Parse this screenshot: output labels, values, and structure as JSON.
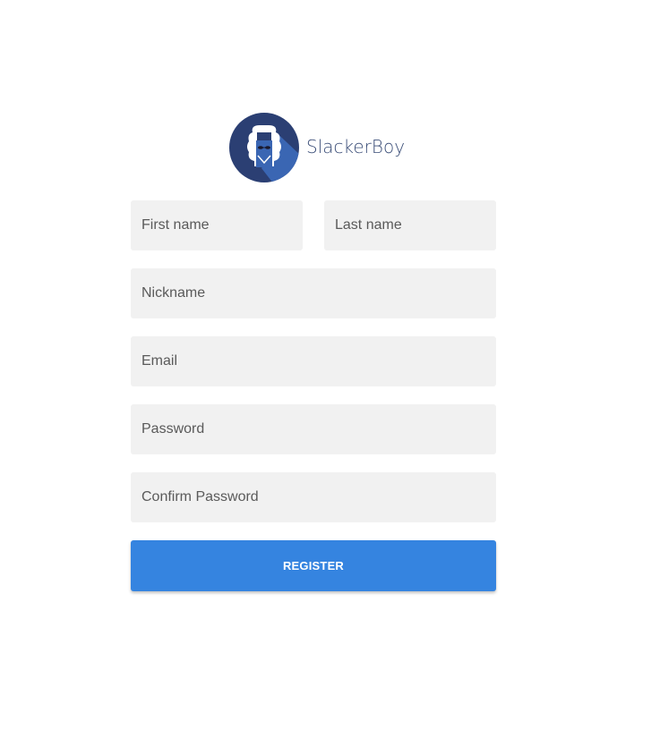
{
  "brand": {
    "name": "SlackerBoy",
    "logo_icon": "slackerboy-logo-icon",
    "text_color": "#3b4e78",
    "circle_color": "#2b3f73",
    "shadow_color": "#3a66b3"
  },
  "form": {
    "first_name": {
      "placeholder": "First name",
      "value": ""
    },
    "last_name": {
      "placeholder": "Last name",
      "value": ""
    },
    "nickname": {
      "placeholder": "Nickname",
      "value": ""
    },
    "email": {
      "placeholder": "Email",
      "value": ""
    },
    "password": {
      "placeholder": "Password",
      "value": ""
    },
    "confirm_password": {
      "placeholder": "Confirm Password",
      "value": ""
    },
    "field_bg": "#f1f1f1",
    "placeholder_color": "#5a5a5a"
  },
  "register": {
    "label": "REGISTER",
    "color": "#3584e0"
  }
}
